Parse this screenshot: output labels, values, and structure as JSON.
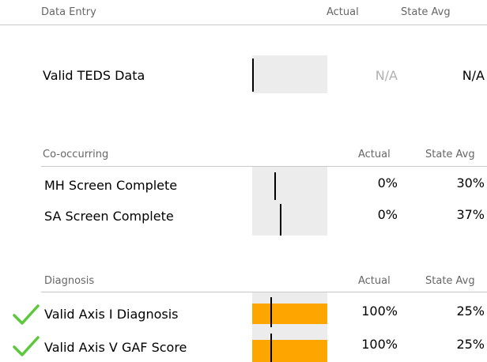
{
  "sections": {
    "data_entry": {
      "title": "Data Entry",
      "col_actual": "Actual",
      "col_state": "State Avg",
      "rows": [
        {
          "label": "Valid TEDS Data",
          "actual": "N/A",
          "state": "N/A",
          "actual_fraction": null,
          "state_fraction": null
        }
      ]
    },
    "co_occurring": {
      "title": "Co-occurring",
      "col_actual": "Actual",
      "col_state": "State Avg",
      "rows": [
        {
          "label": "MH Screen Complete",
          "actual": "0%",
          "state": "30%",
          "actual_fraction": 0.0,
          "state_fraction": 0.3
        },
        {
          "label": "SA Screen Complete",
          "actual": "0%",
          "state": "37%",
          "actual_fraction": 0.0,
          "state_fraction": 0.37
        }
      ]
    },
    "diagnosis": {
      "title": "Diagnosis",
      "col_actual": "Actual",
      "col_state": "State Avg",
      "rows": [
        {
          "label": "Valid Axis I Diagnosis",
          "actual": "100%",
          "state": "25%",
          "actual_fraction": 1.0,
          "state_fraction": 0.25,
          "status_icon": "green-checkmark-icon"
        },
        {
          "label": "Valid Axis V GAF Score",
          "actual": "100%",
          "state": "25%",
          "actual_fraction": 1.0,
          "state_fraction": 0.25,
          "status_icon": "green-checkmark-icon"
        }
      ]
    }
  },
  "colors": {
    "bar_fill": "#ffa500",
    "bar_background": "#ececec",
    "check_green": "#5cc83c",
    "na_grey": "#b0b0b0"
  }
}
